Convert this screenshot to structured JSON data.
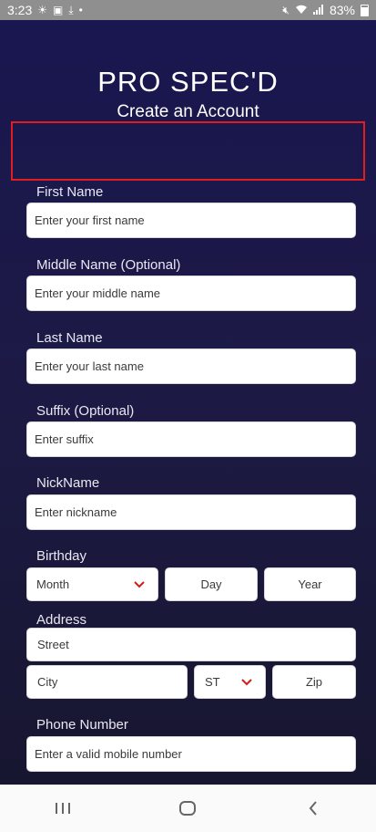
{
  "status": {
    "time": "3:23",
    "battery": "83%"
  },
  "header": {
    "brand": "PRO SPEC'D",
    "subtitle": "Create an Account"
  },
  "form": {
    "first_name": {
      "label": "First Name",
      "placeholder": "Enter your first name"
    },
    "middle_name": {
      "label": "Middle Name (Optional)",
      "placeholder": "Enter your middle name"
    },
    "last_name": {
      "label": "Last Name",
      "placeholder": "Enter your last name"
    },
    "suffix": {
      "label": "Suffix (Optional)",
      "placeholder": "Enter suffix"
    },
    "nickname": {
      "label": "NickName",
      "placeholder": "Enter nickname"
    },
    "birthday": {
      "label": "Birthday",
      "month": "Month",
      "day": "Day",
      "year": "Year"
    },
    "address": {
      "label": "Address",
      "street": "Street",
      "city": "City",
      "state": "ST",
      "zip": "Zip"
    },
    "phone": {
      "label": "Phone Number",
      "placeholder": "Enter a valid mobile number"
    }
  },
  "colors": {
    "accent_error": "#e11d1d",
    "background": "#1b1848"
  },
  "icons": [
    "sun-icon",
    "gallery-icon",
    "download-icon",
    "mute-icon",
    "wifi-icon",
    "signal-icon",
    "battery-icon",
    "chevron-down-icon",
    "recents-icon",
    "home-icon",
    "back-icon"
  ]
}
